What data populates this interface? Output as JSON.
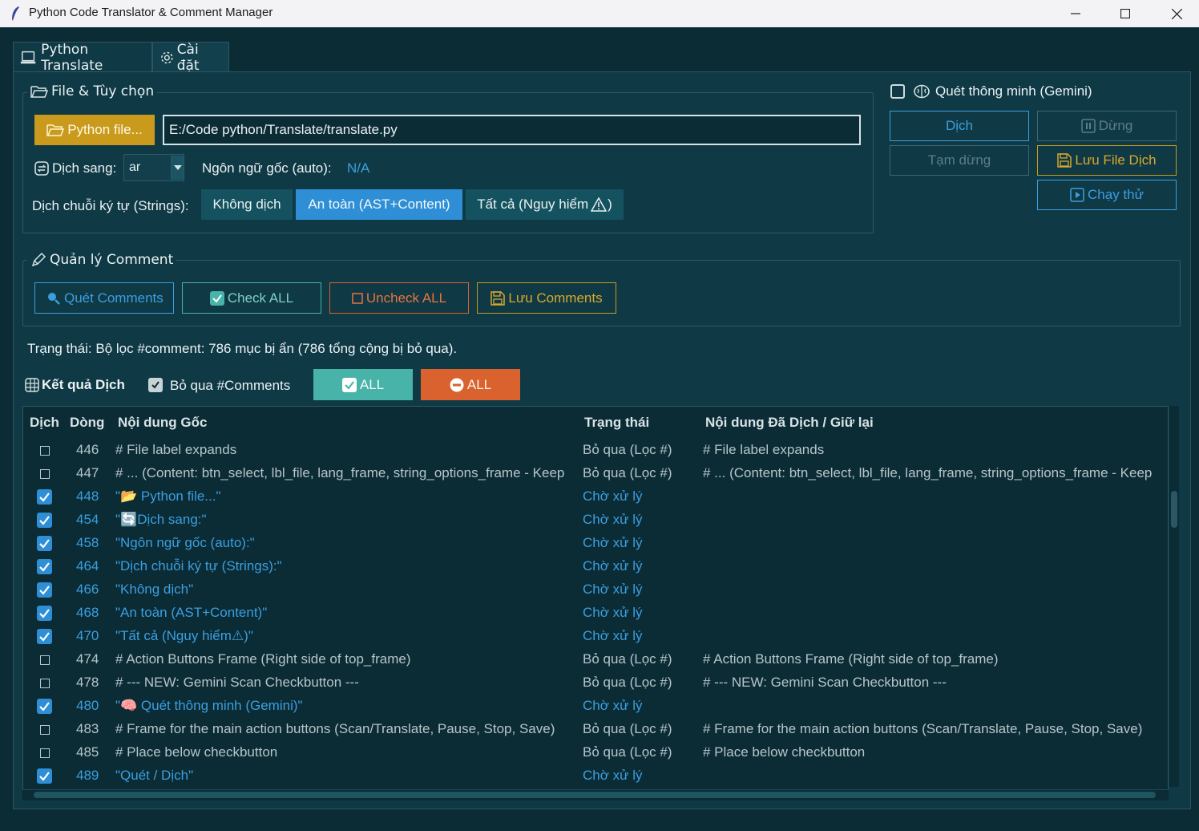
{
  "window": {
    "title": "Python Code Translator & Comment Manager",
    "icons": {
      "app": "feather-icon",
      "minimize": "minimize-icon",
      "maximize": "maximize-icon",
      "close": "close-icon"
    }
  },
  "tabs": [
    {
      "label": "Python Translate",
      "icon": "laptop-icon",
      "active": true
    },
    {
      "label": "Cài đặt",
      "icon": "gear-icon",
      "active": false
    }
  ],
  "file_options": {
    "title": "File & Tùy chọn",
    "python_file_button": "Python file...",
    "file_path": "E:/Code python/Translate/translate.py",
    "translate_to_label": "Dịch sang:",
    "target_lang": "ar",
    "source_lang_label": "Ngôn ngữ gốc (auto):",
    "source_lang_value": "N/A",
    "strings_label": "Dịch chuỗi ký tự (Strings):",
    "strings_options": [
      "Không dịch",
      "An toàn (AST+Content)",
      "Tất cả (Nguy hiểm",
      ")"
    ],
    "strings_selected": "An toàn (AST+Content)"
  },
  "actions": {
    "smart_scan_label": "Quét thông minh (Gemini)",
    "smart_scan_checked": false,
    "translate_button": "Dịch",
    "stop_button": "Dừng",
    "pause_button": "Tạm dừng",
    "save_translation_button": "Lưu File Dịch",
    "test_run_button": "Chạy thử"
  },
  "comment_manager": {
    "title": "Quản lý Comment",
    "scan_button": "Quét Comments",
    "check_all_button": "Check ALL",
    "uncheck_all_button": "Uncheck ALL",
    "save_comments_button": "Lưu Comments"
  },
  "status": {
    "text": "Trạng thái: Bộ lọc #comment: 786 mục bị ẩn (786 tổng cộng bị bỏ qua)."
  },
  "results": {
    "title": "Kết quả Dịch",
    "skip_comments_label": "Bỏ qua #Comments",
    "skip_comments_checked": true,
    "all_check_button": "ALL",
    "all_uncheck_button": "ALL",
    "colors": {
      "teal": "#48b3a8",
      "orange": "#d9622e",
      "pending": "#3b9fe0",
      "skipped": "#b6c6ca"
    }
  },
  "table": {
    "columns": [
      "Dịch",
      "Dòng",
      "Nội dung Gốc",
      "Trạng thái",
      "Nội dung Đã Dịch / Giữ lại"
    ],
    "rows": [
      {
        "checked": false,
        "line": "446",
        "original": "# File label expands",
        "status": "Bỏ qua (Lọc #)",
        "translated": "# File label expands"
      },
      {
        "checked": false,
        "line": "447",
        "original": "# ... (Content: btn_select, lbl_file, lang_frame, string_options_frame - Keep",
        "status": "Bỏ qua (Lọc #)",
        "translated": "# ... (Content: btn_select, lbl_file, lang_frame, string_options_frame - Keep"
      },
      {
        "checked": true,
        "line": "448",
        "original": "\"📂 Python file...\"",
        "status": "Chờ xử lý",
        "translated": ""
      },
      {
        "checked": true,
        "line": "454",
        "original": "\"🔄Dịch sang:\"",
        "status": "Chờ xử lý",
        "translated": ""
      },
      {
        "checked": true,
        "line": "458",
        "original": "\"Ngôn ngữ gốc (auto):\"",
        "status": "Chờ xử lý",
        "translated": ""
      },
      {
        "checked": true,
        "line": "464",
        "original": "\"Dịch chuỗi ký tự (Strings):\"",
        "status": "Chờ xử lý",
        "translated": ""
      },
      {
        "checked": true,
        "line": "466",
        "original": "\"Không dịch\"",
        "status": "Chờ xử lý",
        "translated": ""
      },
      {
        "checked": true,
        "line": "468",
        "original": "\"An toàn (AST+Content)\"",
        "status": "Chờ xử lý",
        "translated": ""
      },
      {
        "checked": true,
        "line": "470",
        "original": "\"Tất cả (Nguy hiểm⚠)\"",
        "status": "Chờ xử lý",
        "translated": ""
      },
      {
        "checked": false,
        "line": "474",
        "original": "# Action Buttons Frame (Right side of top_frame)",
        "status": "Bỏ qua (Lọc #)",
        "translated": "# Action Buttons Frame (Right side of top_frame)"
      },
      {
        "checked": false,
        "line": "478",
        "original": "# --- NEW: Gemini Scan Checkbutton ---",
        "status": "Bỏ qua (Lọc #)",
        "translated": "# --- NEW: Gemini Scan Checkbutton ---"
      },
      {
        "checked": true,
        "line": "480",
        "original": "\"🧠 Quét thông minh (Gemini)\"",
        "status": "Chờ xử lý",
        "translated": ""
      },
      {
        "checked": false,
        "line": "483",
        "original": "# Frame for the main action buttons (Scan/Translate, Pause, Stop, Save)",
        "status": "Bỏ qua (Lọc #)",
        "translated": "# Frame for the main action buttons (Scan/Translate, Pause, Stop, Save)"
      },
      {
        "checked": false,
        "line": "485",
        "original": "# Place below checkbutton",
        "status": "Bỏ qua (Lọc #)",
        "translated": "# Place below checkbutton"
      },
      {
        "checked": true,
        "line": "489",
        "original": "\"Quét / Dịch\"",
        "status": "Chờ xử lý",
        "translated": ""
      }
    ]
  }
}
